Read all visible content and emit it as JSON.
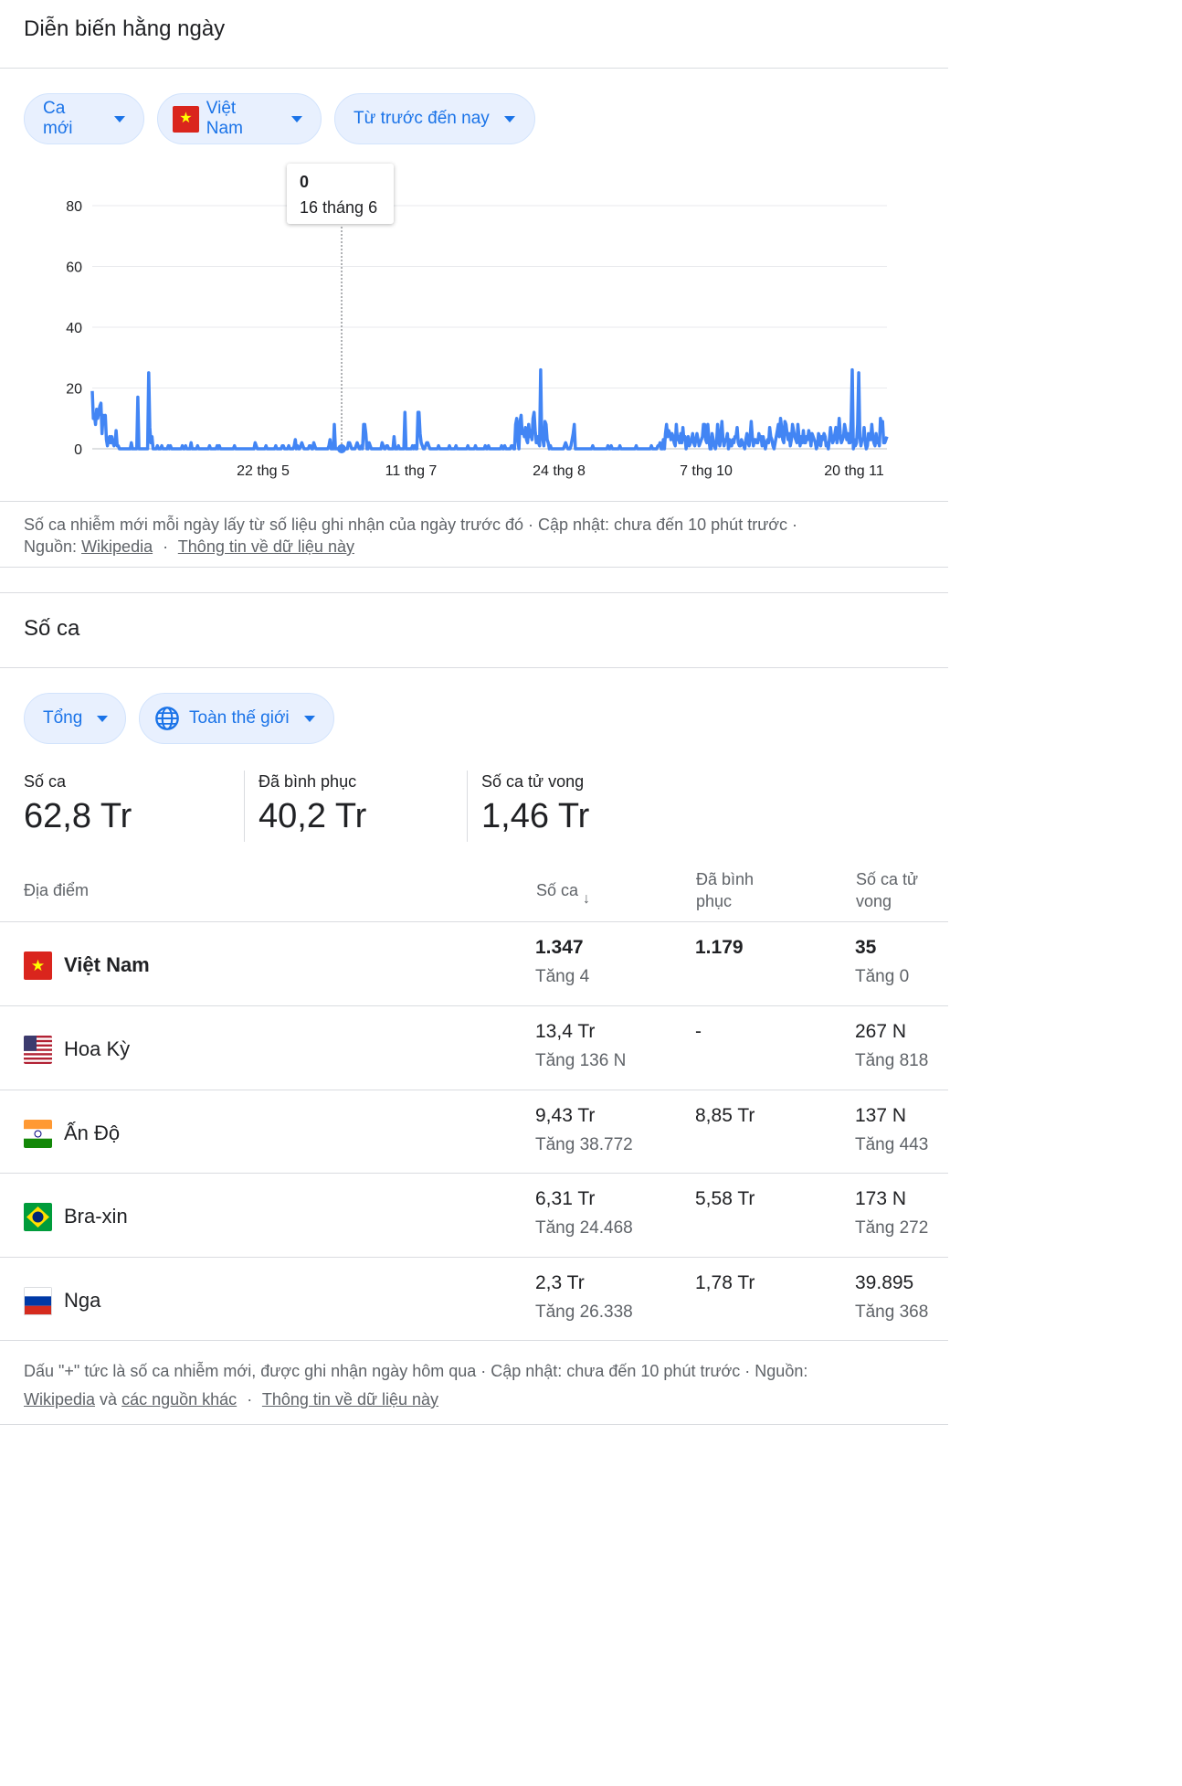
{
  "daily": {
    "title": "Diễn biến hằng ngày",
    "chips": {
      "metric": "Ca mới",
      "country": "Việt Nam",
      "range": "Từ trước đến nay"
    },
    "tooltip": {
      "value": "0",
      "date": "16 tháng 6"
    },
    "footer": {
      "text": "Số ca nhiễm mới mỗi ngày lấy từ số liệu ghi nhận của ngày trước đó · Cập nhật: chưa đến 10 phút trước ·",
      "source_prefix": "Nguồn:",
      "source_link": "Wikipedia",
      "sep": "·",
      "info_link": "Thông tin về dữ liệu này"
    }
  },
  "chart_data": {
    "type": "line",
    "title": "",
    "xlabel": "",
    "ylabel": "",
    "ylim": [
      0,
      80
    ],
    "yticks": [
      "0",
      "20",
      "40",
      "60",
      "80"
    ],
    "xticks": [
      "22 thg 5",
      "11 thg 7",
      "24 thg 8",
      "7 thg 10",
      "20 thg 11"
    ],
    "grid": true,
    "color": "#4285f4",
    "series": [
      {
        "values": [
          19,
          10,
          11,
          8,
          13,
          10,
          12,
          14,
          15,
          5,
          11,
          10,
          11,
          3,
          1,
          3,
          4,
          2,
          4,
          2,
          1,
          2,
          6,
          1,
          1,
          0,
          0,
          0,
          0,
          0,
          0,
          0,
          0,
          0,
          0,
          0,
          2,
          0,
          0,
          0,
          0,
          0,
          17,
          0,
          0,
          0,
          0,
          0,
          0,
          0,
          0,
          0,
          25,
          7,
          2,
          4,
          0,
          0,
          0,
          0,
          1,
          0,
          0,
          0,
          1,
          0,
          0,
          0,
          0,
          0,
          1,
          0,
          1,
          0,
          0,
          0,
          0,
          0,
          0,
          0,
          0,
          0,
          0,
          1,
          0,
          0,
          1,
          0,
          0,
          0,
          0,
          2,
          0,
          0,
          0,
          0,
          0,
          1,
          0,
          0,
          0,
          0,
          0,
          0,
          0,
          0,
          0,
          0,
          1,
          0,
          0,
          0,
          0,
          0,
          0,
          1,
          0,
          1,
          0,
          0,
          0,
          0,
          0,
          0,
          0,
          0,
          0,
          0,
          0,
          0,
          0,
          1,
          0,
          0,
          0,
          0,
          0,
          0,
          0,
          0,
          0,
          0,
          0,
          0,
          0,
          0,
          0,
          0,
          0,
          0,
          2,
          1,
          0,
          0,
          0,
          0,
          0,
          0,
          0,
          0,
          1,
          0,
          0,
          0,
          0,
          0,
          0,
          0,
          0,
          1,
          0,
          0,
          0,
          0,
          0,
          1,
          1,
          0,
          0,
          0,
          0,
          1,
          0,
          0,
          0,
          0,
          1,
          3,
          0,
          1,
          0,
          0,
          1,
          2,
          1,
          0,
          0,
          0,
          0,
          0,
          1,
          1,
          0,
          0,
          2,
          1,
          0,
          0,
          0,
          0,
          0,
          0,
          0,
          0,
          0,
          0,
          0,
          0,
          1,
          3,
          0,
          0,
          0,
          8,
          0,
          0,
          0,
          0,
          0,
          0,
          1,
          0,
          0,
          0,
          0,
          0,
          2,
          2,
          1,
          0,
          0,
          0,
          0,
          1,
          2,
          1,
          0,
          0,
          1,
          0,
          8,
          8,
          5,
          0,
          0,
          2,
          1,
          0,
          0,
          0,
          0,
          0,
          0,
          0,
          0,
          0,
          0,
          2,
          1,
          0,
          0,
          1,
          1,
          0,
          0,
          0,
          0,
          0,
          4,
          0,
          0,
          0,
          1,
          0,
          0,
          0,
          0,
          0,
          12,
          0,
          0,
          0,
          0,
          0,
          0,
          1,
          0,
          1,
          0,
          0,
          12,
          12,
          5,
          2,
          1,
          0,
          0,
          1,
          2,
          2,
          1,
          0,
          0,
          0,
          0,
          0,
          0,
          0,
          0,
          1,
          0,
          0,
          0,
          0,
          0,
          0,
          0,
          0,
          0,
          1,
          0,
          0,
          0,
          0,
          0,
          1,
          0,
          0,
          0,
          0,
          0,
          0,
          0,
          0,
          0,
          0,
          1,
          0,
          0,
          0,
          0,
          0,
          0,
          1,
          0,
          0,
          0,
          0,
          0,
          0,
          0,
          0,
          1,
          0,
          0,
          1,
          0,
          0,
          0,
          0,
          0,
          0,
          0,
          0,
          0,
          0,
          0,
          1,
          0,
          0,
          1,
          0,
          0,
          0,
          0,
          0,
          1,
          1,
          0,
          0,
          8,
          10,
          3,
          0,
          9,
          11,
          5,
          6,
          4,
          7,
          3,
          2,
          8,
          4,
          6,
          3,
          10,
          12,
          6,
          2,
          4,
          2,
          1,
          26,
          4,
          3,
          1,
          9,
          8,
          3,
          2,
          0,
          1,
          0,
          0,
          0,
          0,
          0,
          0,
          0,
          0,
          0,
          0,
          0,
          0,
          1,
          2,
          1,
          0,
          0,
          0,
          1,
          3,
          5,
          8,
          0,
          0,
          0,
          0,
          0,
          0,
          0,
          0,
          0,
          0,
          0,
          0,
          0,
          0,
          0,
          0,
          1,
          0,
          0,
          0,
          0,
          0,
          0,
          0,
          0,
          0,
          0,
          0,
          0,
          0,
          1,
          0,
          0,
          1,
          0,
          0,
          0,
          0,
          0,
          0,
          0,
          1,
          0,
          0,
          0,
          0,
          0,
          0,
          0,
          0,
          0,
          0,
          0,
          0,
          0,
          0,
          1,
          0,
          0,
          0,
          0,
          0,
          0,
          0,
          0,
          0,
          0,
          0,
          0,
          0,
          1,
          0,
          0,
          0,
          0,
          0,
          1,
          1,
          2,
          0,
          0,
          3,
          0,
          5,
          8,
          4,
          6,
          5,
          3,
          5,
          4,
          2,
          1,
          8,
          3,
          4,
          2,
          5,
          2,
          7,
          3,
          4,
          0,
          2,
          4,
          1,
          2,
          3,
          5,
          2,
          1,
          3,
          5,
          3,
          1,
          2,
          3,
          4,
          8,
          8,
          3,
          2,
          8,
          3,
          0,
          0,
          5,
          3,
          1,
          0,
          2,
          8,
          3,
          1,
          5,
          9,
          3,
          1,
          3,
          3,
          5,
          0,
          3,
          1,
          1,
          3,
          2,
          4,
          4,
          7,
          2,
          1,
          1,
          3,
          2,
          1,
          0,
          3,
          5,
          2,
          1,
          4,
          9,
          4,
          1,
          3,
          3,
          2,
          2,
          5,
          3,
          4,
          1,
          4,
          2,
          0,
          2,
          3,
          2,
          7,
          4,
          3,
          1,
          0,
          2,
          4,
          6,
          8,
          4,
          10,
          7,
          3,
          2,
          9,
          8,
          5,
          3,
          5,
          1,
          3,
          8,
          6,
          4,
          3,
          2,
          8,
          4,
          1,
          4,
          2,
          6,
          2,
          2,
          4,
          3,
          6,
          4,
          1,
          5,
          4,
          3,
          2,
          0,
          1,
          5,
          4,
          1,
          4,
          3,
          5,
          4,
          1,
          2,
          0,
          3,
          7,
          4,
          2,
          3,
          5,
          7,
          2,
          4,
          10,
          5,
          2,
          3,
          4,
          8,
          6,
          3,
          5,
          2,
          2,
          9,
          26,
          0,
          3,
          1,
          2,
          8,
          25,
          4,
          1,
          3,
          3,
          7,
          2,
          0,
          1,
          5,
          3,
          3,
          8,
          4,
          2,
          1,
          5,
          2,
          3,
          1,
          10,
          7,
          9,
          2,
          2,
          3,
          4
        ]
      }
    ]
  },
  "cases": {
    "title": "Số ca",
    "chips": {
      "metric": "Tổng",
      "region": "Toàn thế giới"
    },
    "stats": [
      {
        "label": "Số ca",
        "value": "62,8 Tr"
      },
      {
        "label": "Đã bình phục",
        "value": "40,2 Tr"
      },
      {
        "label": "Số ca tử vong",
        "value": "1,46 Tr"
      }
    ],
    "table": {
      "headers": {
        "location": "Địa điểm",
        "cases": "Số ca",
        "recovered_1": "Đã bình",
        "recovered_2": "phục",
        "deaths_1": "Số ca tử",
        "deaths_2": "vong"
      },
      "rows": [
        {
          "name": "Việt Nam",
          "flag": "vn",
          "cases": "1.347",
          "cases_inc": "Tăng 4",
          "recovered": "1.179",
          "deaths": "35",
          "deaths_inc": "Tăng 0"
        },
        {
          "name": "Hoa Kỳ",
          "flag": "us",
          "cases": "13,4 Tr",
          "cases_inc": "Tăng 136 N",
          "recovered": "-",
          "deaths": "267 N",
          "deaths_inc": "Tăng 818"
        },
        {
          "name": "Ấn Độ",
          "flag": "in",
          "cases": "9,43 Tr",
          "cases_inc": "Tăng 38.772",
          "recovered": "8,85 Tr",
          "deaths": "137 N",
          "deaths_inc": "Tăng 443"
        },
        {
          "name": "Bra-xin",
          "flag": "br",
          "cases": "6,31 Tr",
          "cases_inc": "Tăng 24.468",
          "recovered": "5,58 Tr",
          "deaths": "173 N",
          "deaths_inc": "Tăng 272"
        },
        {
          "name": "Nga",
          "flag": "ru",
          "cases": "2,3 Tr",
          "cases_inc": "Tăng 26.338",
          "recovered": "1,78 Tr",
          "deaths": "39.895",
          "deaths_inc": "Tăng 368"
        }
      ]
    },
    "footer": {
      "text": "Dấu \"+\" tức là số ca nhiễm mới, được ghi nhận ngày hôm qua · Cập nhật: chưa đến 10 phút trước · Nguồn:",
      "source_link": "Wikipedia",
      "and": "và",
      "other_link": "các nguồn khác",
      "sep": "·",
      "info_link": "Thông tin về dữ liệu này"
    }
  }
}
